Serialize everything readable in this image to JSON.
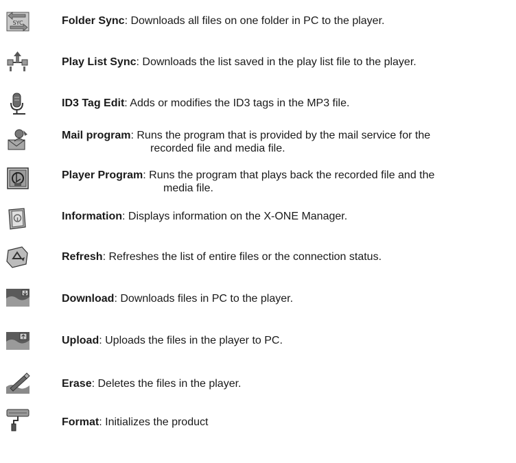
{
  "items": [
    {
      "icon": "folder-sync-icon",
      "term": "Folder Sync",
      "text": ": Downloads all files on one folder in PC to the player.",
      "text2": ""
    },
    {
      "icon": "play-list-sync-icon",
      "term": "Play List Sync",
      "text": ": Downloads the list saved in the play list file to the player.",
      "text2": ""
    },
    {
      "icon": "id3-tag-edit-icon",
      "term": "ID3 Tag Edit",
      "text": ": Adds or modifies the ID3 tags in the MP3 file.",
      "text2": ""
    },
    {
      "icon": "mail-program-icon",
      "term": "Mail program",
      "text": ": Runs the program that is provided by the mail service for the",
      "text2": "recorded file and media file."
    },
    {
      "icon": "player-program-icon",
      "term": "Player Program",
      "text": ": Runs the program that plays back the recorded file and the",
      "text2": "media file."
    },
    {
      "icon": "information-icon",
      "term": "Information",
      "text": ": Displays information on the X-ONE Manager.",
      "text2": ""
    },
    {
      "icon": "refresh-icon",
      "term": "Refresh",
      "text": ": Refreshes the list of entire files or the connection status.",
      "text2": ""
    },
    {
      "icon": "download-icon",
      "term": "Download",
      "text": ": Downloads files in PC to the player.",
      "text2": ""
    },
    {
      "icon": "upload-icon",
      "term": "Upload",
      "text": ": Uploads the files in the player to PC.",
      "text2": ""
    },
    {
      "icon": "erase-icon",
      "term": "Erase",
      "text": ": Deletes the files in the player.",
      "text2": ""
    },
    {
      "icon": "format-icon",
      "term": "Format",
      "text": ": Initializes the product",
      "text2": ""
    }
  ],
  "icon_labels": {
    "folder_sync": "SYC"
  }
}
